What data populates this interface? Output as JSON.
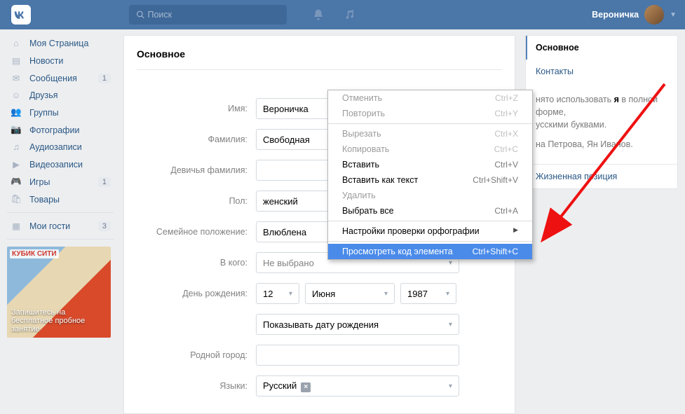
{
  "top": {
    "search_placeholder": "Поиск",
    "username": "Вероничка"
  },
  "sidebar": {
    "items": [
      {
        "label": "Моя Страница"
      },
      {
        "label": "Новости"
      },
      {
        "label": "Сообщения",
        "badge": "1"
      },
      {
        "label": "Друзья"
      },
      {
        "label": "Группы"
      },
      {
        "label": "Фотографии"
      },
      {
        "label": "Аудиозаписи"
      },
      {
        "label": "Видеозаписи"
      },
      {
        "label": "Игры",
        "badge": "1"
      },
      {
        "label": "Товары"
      }
    ],
    "guests": {
      "label": "Мои гости",
      "badge": "3"
    },
    "ad_brand": "КУБИК СИТИ",
    "ad_text": "Запишитесь на бесплатное пробное занятие"
  },
  "form": {
    "title": "Основное",
    "labels": {
      "name": "Имя:",
      "surname": "Фамилия:",
      "maiden": "Девичья фамилия:",
      "sex": "Пол:",
      "marital": "Семейное положение:",
      "whom": "В кого:",
      "bday": "День рождения:",
      "bday_show": "Показывать дату рождения",
      "home": "Родной город:",
      "langs": "Языки:"
    },
    "values": {
      "name": "Вероничка",
      "surname": "Свободная",
      "maiden": "",
      "sex": "женский",
      "marital": "Влюблена",
      "whom": "Не выбрано",
      "day": "12",
      "month": "Июня",
      "year": "1987",
      "bday_show": "Показывать дату рождения",
      "home": "",
      "lang": "Русский"
    }
  },
  "rcol": {
    "tab_main": "Основное",
    "tab_contacts": "Контакты",
    "info1a": "нято использовать ",
    "info1b": "я",
    "info1c": " в полной форме,",
    "info2": "усскими буквами.",
    "examples": "на Петрова, Ян Иванов.",
    "life": "Жизненная позиция"
  },
  "ctx": {
    "undo": "Отменить",
    "undo_sc": "Ctrl+Z",
    "redo": "Повторить",
    "redo_sc": "Ctrl+Y",
    "cut": "Вырезать",
    "cut_sc": "Ctrl+X",
    "copy": "Копировать",
    "copy_sc": "Ctrl+C",
    "paste": "Вставить",
    "paste_sc": "Ctrl+V",
    "paste_txt": "Вставить как текст",
    "paste_txt_sc": "Ctrl+Shift+V",
    "delete": "Удалить",
    "select_all": "Выбрать все",
    "select_all_sc": "Ctrl+A",
    "spell": "Настройки проверки орфографии",
    "inspect": "Просмотреть код элемента",
    "inspect_sc": "Ctrl+Shift+C"
  }
}
